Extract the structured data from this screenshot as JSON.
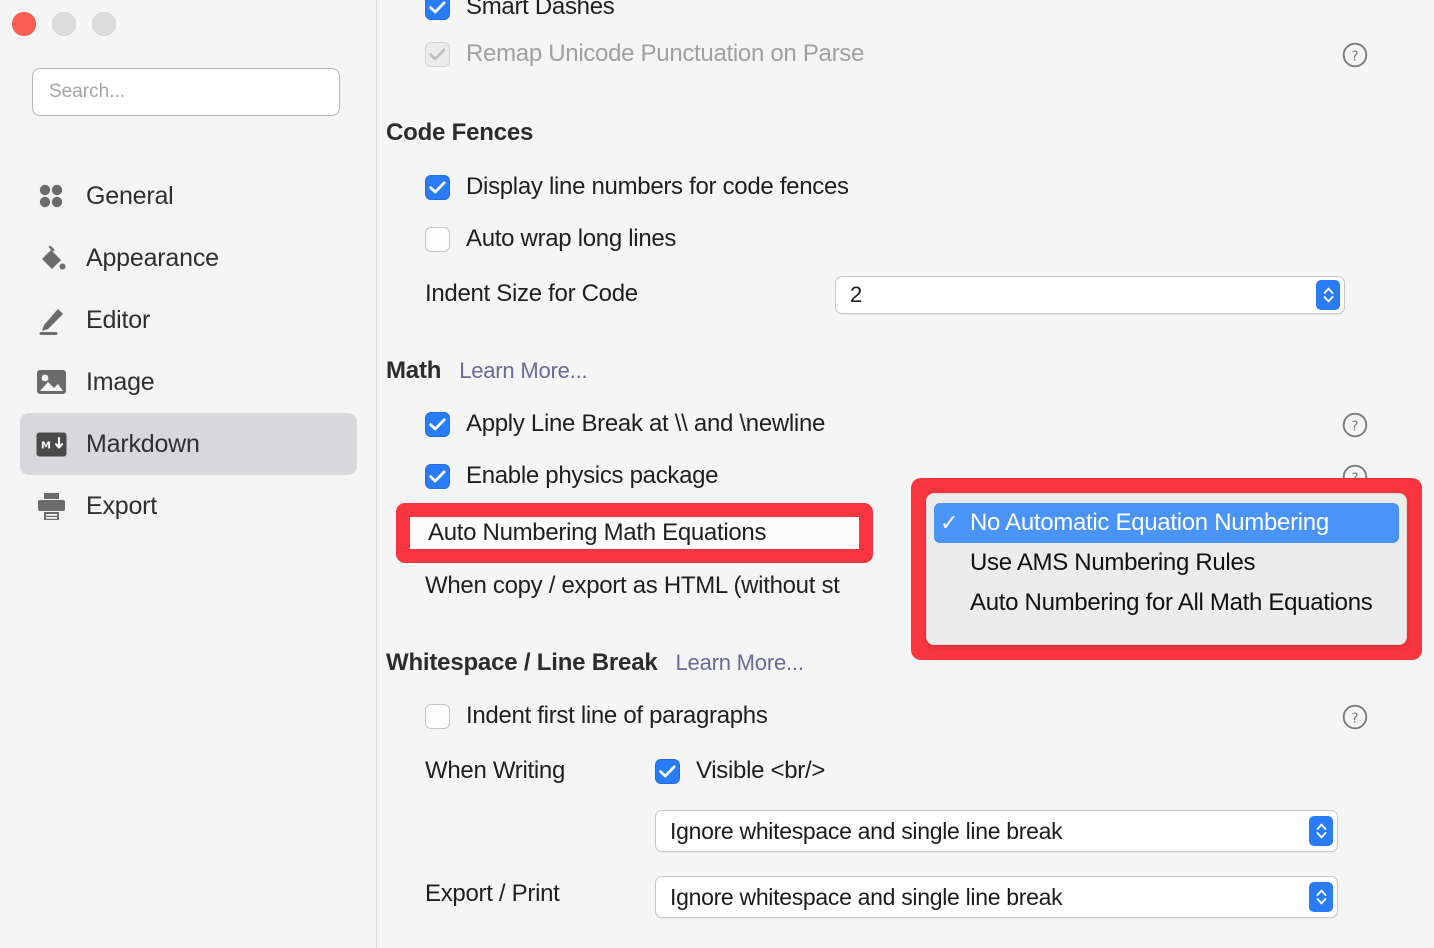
{
  "window": {
    "traffic_lights": [
      "close",
      "minimize",
      "zoom"
    ]
  },
  "sidebar": {
    "search": {
      "placeholder": "Search...",
      "value": ""
    },
    "items": [
      {
        "label": "General",
        "icon": "four-dots-icon",
        "selected": false
      },
      {
        "label": "Appearance",
        "icon": "paint-bucket-icon",
        "selected": false
      },
      {
        "label": "Editor",
        "icon": "pencil-icon",
        "selected": false
      },
      {
        "label": "Image",
        "icon": "picture-icon",
        "selected": false
      },
      {
        "label": "Markdown",
        "icon": "markdown-icon",
        "selected": true
      },
      {
        "label": "Export",
        "icon": "printer-icon",
        "selected": false
      }
    ]
  },
  "main": {
    "smart_dashes": {
      "label": "Smart Dashes",
      "checked": true
    },
    "remap_unicode": {
      "label": "Remap Unicode Punctuation on Parse",
      "checked": true,
      "disabled": true
    },
    "code_fences": {
      "title": "Code Fences",
      "display_line_numbers": {
        "label": "Display line numbers for code fences",
        "checked": true
      },
      "auto_wrap": {
        "label": "Auto wrap long lines",
        "checked": false
      },
      "indent_size": {
        "label": "Indent Size for Code",
        "value": "2"
      }
    },
    "math": {
      "title": "Math",
      "learn_more": "Learn More...",
      "apply_line_break": {
        "label": "Apply Line Break at \\\\ and \\newline",
        "checked": true
      },
      "enable_physics": {
        "label": "Enable physics package",
        "checked": true
      },
      "auto_numbering_label": "Auto Numbering Math Equations",
      "when_copy_export": "When copy / export as HTML (without st",
      "menu": {
        "options": [
          {
            "label": "No Automatic Equation Numbering",
            "selected": true
          },
          {
            "label": "Use AMS Numbering Rules",
            "selected": false
          },
          {
            "label": "Auto Numbering for All Math Equations",
            "selected": false
          }
        ],
        "check_glyph": "✓"
      }
    },
    "whitespace": {
      "title": "Whitespace / Line Break",
      "learn_more": "Learn More...",
      "indent_first_line": {
        "label": "Indent first line of paragraphs",
        "checked": false
      },
      "when_writing": {
        "label": "When Writing",
        "visible_br": {
          "label": "Visible <br/>",
          "checked": true
        },
        "select_value": "Ignore whitespace and single line break"
      },
      "export_print": {
        "label": "Export / Print",
        "select_value": "Ignore whitespace and single line break"
      }
    }
  },
  "colors": {
    "accent_blue": "#2a7bf6",
    "menu_highlight": "#4a93f8",
    "annotation_red": "#f9353f",
    "link_purple": "#6a6a96",
    "sidebar_bg": "#f4f4f4",
    "selected_row": "#d8d8dc"
  }
}
